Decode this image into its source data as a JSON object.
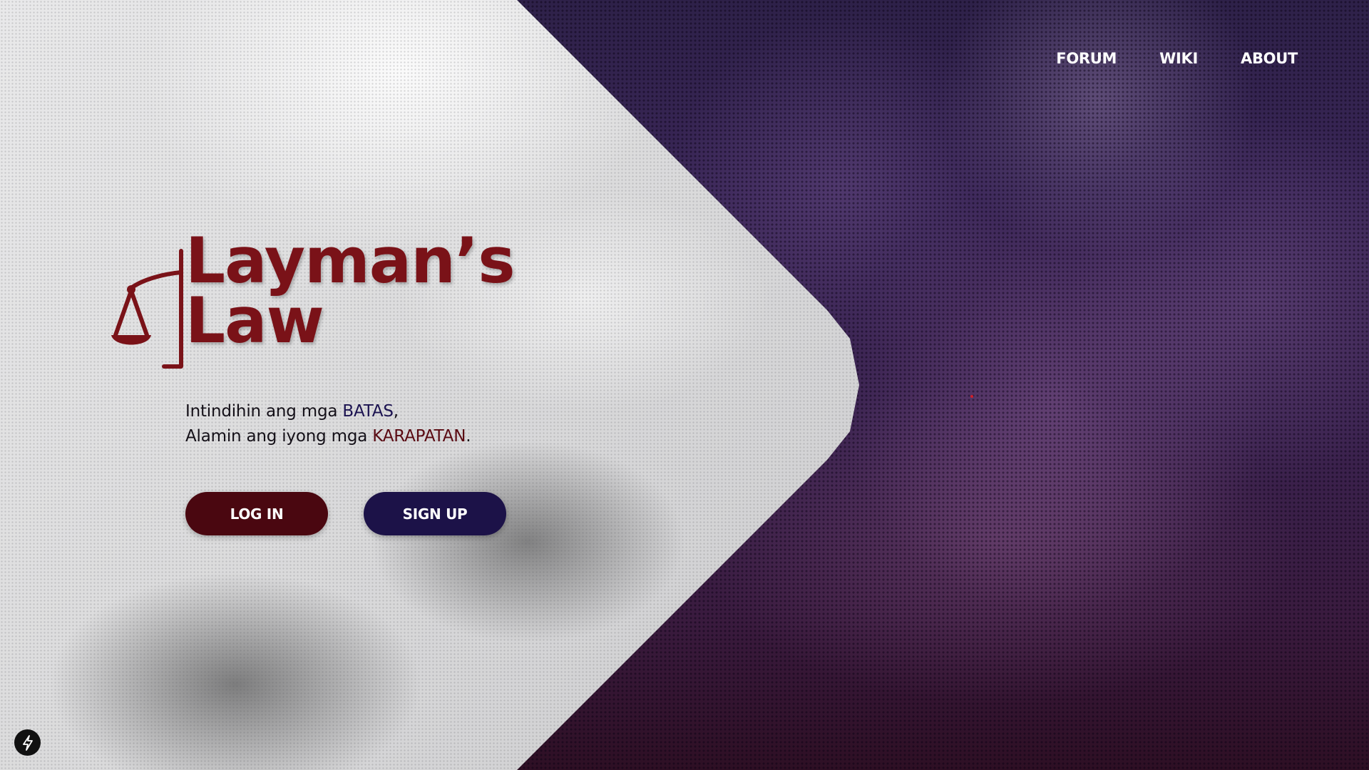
{
  "nav": {
    "items": [
      {
        "label": "FORUM"
      },
      {
        "label": "WIKI"
      },
      {
        "label": "ABOUT"
      }
    ]
  },
  "logo": {
    "line1": "Layman’s",
    "line2": "Law",
    "icon": "scales-of-justice-icon"
  },
  "tagline": {
    "line1_prefix": "Intindihin ang mga ",
    "line1_highlight": "BATAS",
    "line1_suffix": ",",
    "line2_prefix": "Alamin ang iyong mga ",
    "line2_highlight": "KARAPATAN",
    "line2_suffix": "."
  },
  "buttons": {
    "login_label": "LOG IN",
    "signup_label": "SIGN UP"
  },
  "badge": {
    "icon": "lightning-bolt-icon"
  },
  "colors": {
    "brand_red": "#7a1218",
    "login_button": "#4a0710",
    "signup_button": "#1c1248",
    "highlight_batas": "#1b1250",
    "highlight_karapatan": "#5a0a12",
    "nav_text": "#ffffff",
    "background_purple": "#3a2657"
  }
}
